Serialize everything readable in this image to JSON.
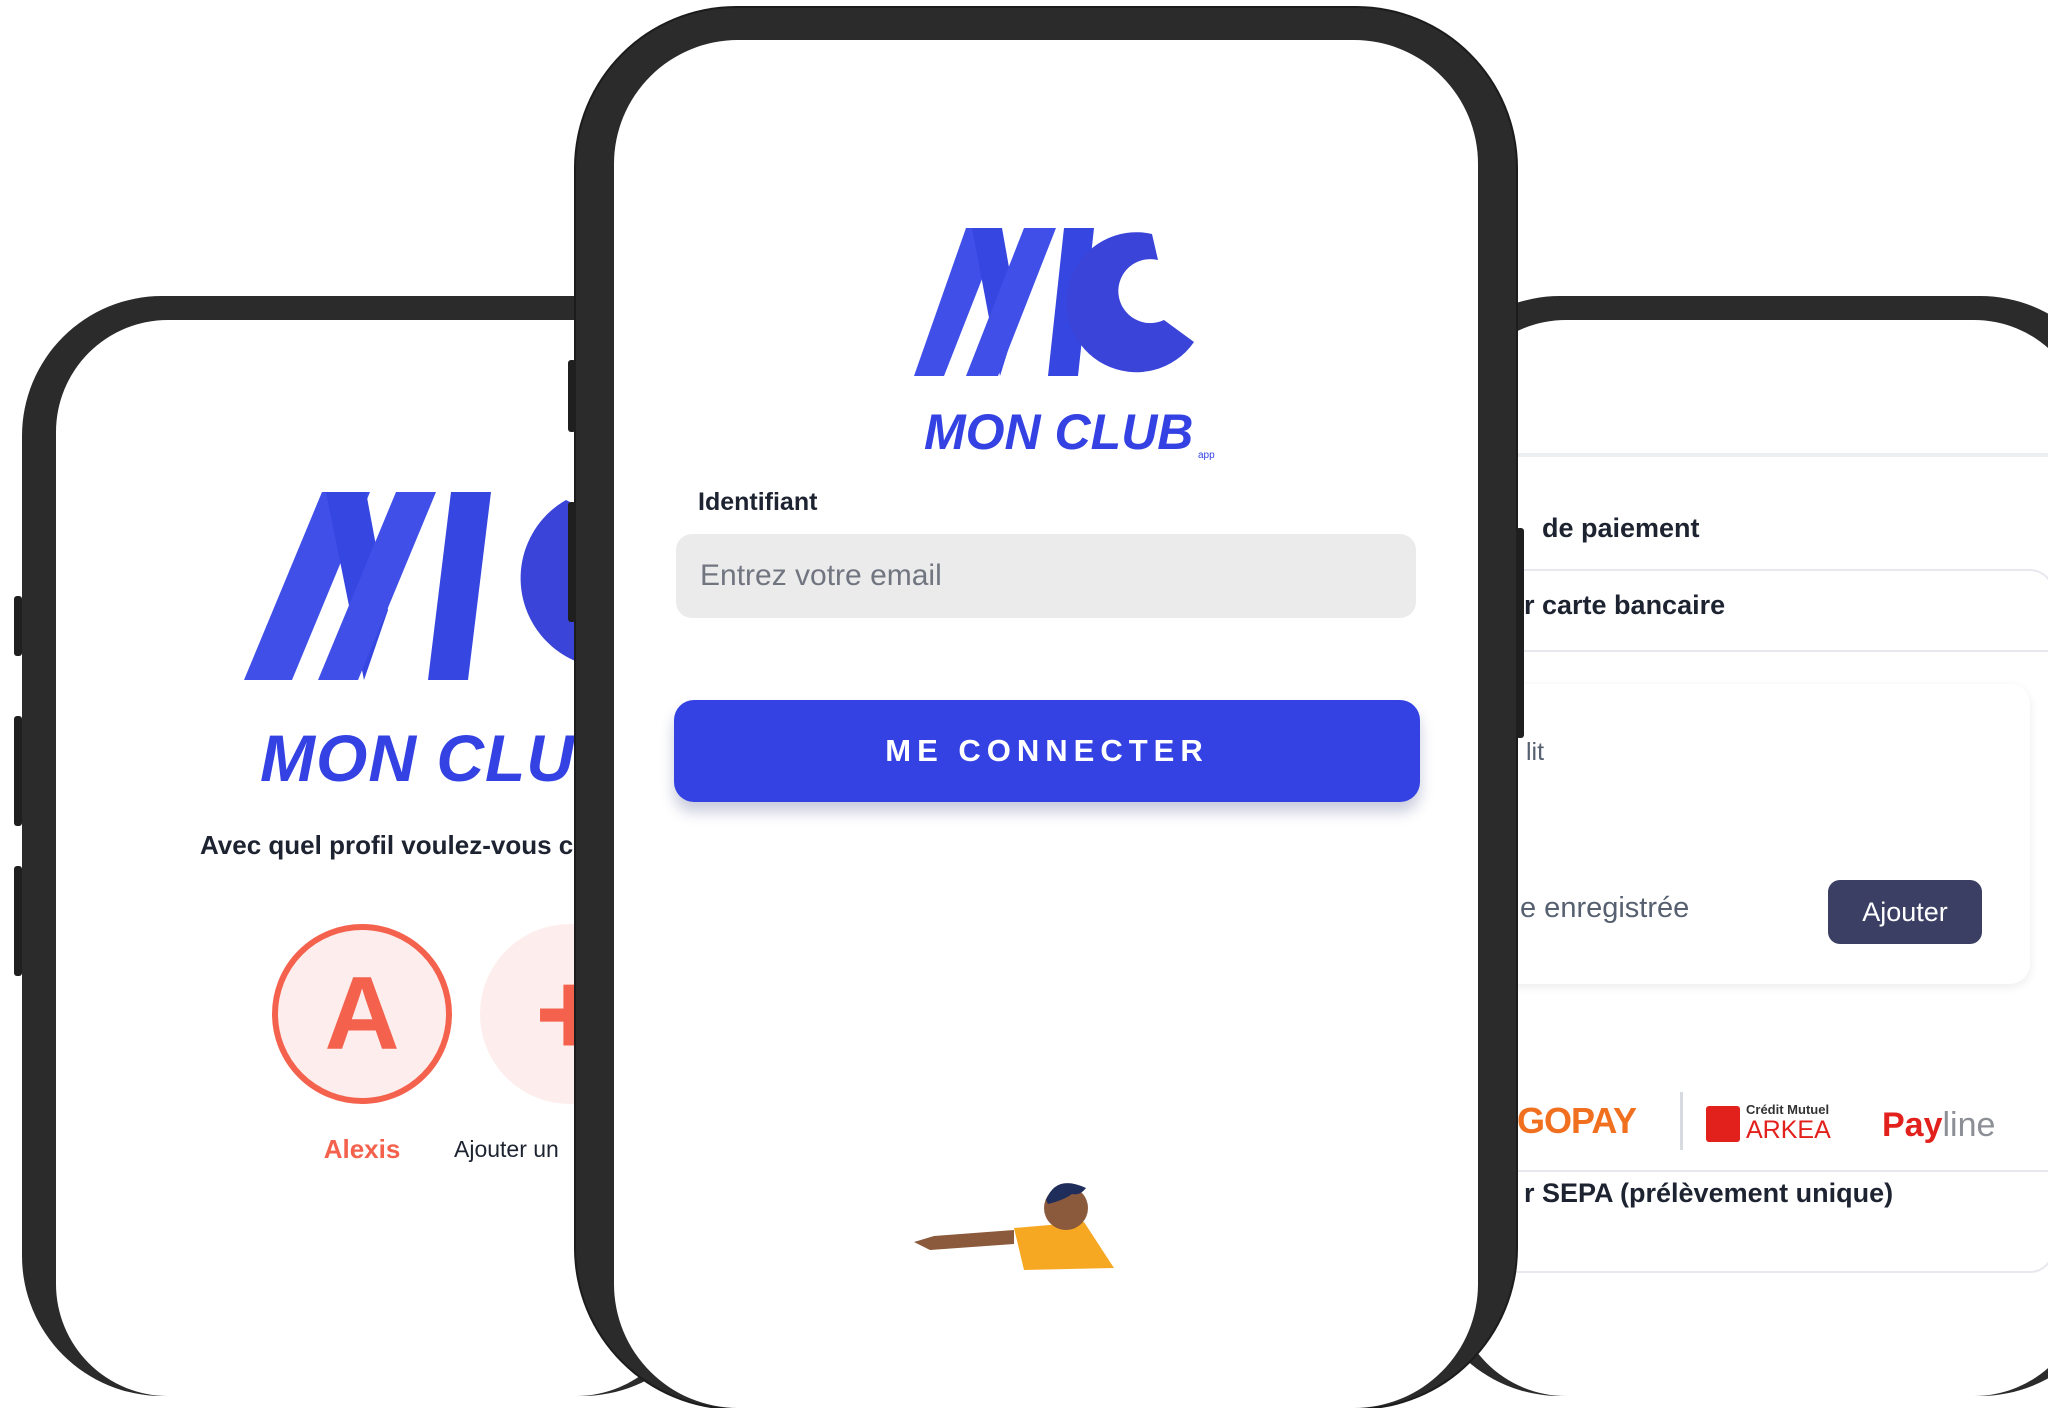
{
  "brand": {
    "name": "MON CLUB",
    "suffix": "app",
    "primary_color": "#3442e3",
    "accent_color": "#f4624e"
  },
  "left_phone": {
    "question": "Avec quel profil voulez-vous co",
    "profile": {
      "initial": "A",
      "name": "Alexis"
    },
    "add_symbol": "+",
    "add_label": "Ajouter un"
  },
  "center_phone": {
    "login_label": "Identifiant",
    "email_placeholder": "Entrez votre email",
    "email_value": "",
    "connect_button": "ME CONNECTER"
  },
  "right_phone": {
    "section_title": "de paiement",
    "card_title": "r carte bancaire",
    "credit_label": "lit",
    "saved_label": "e enregistrée",
    "add_button": "Ajouter",
    "mangopay": "NGOPAY",
    "arkea_small": "Crédit Mutuel",
    "arkea": "ARKEA",
    "payline_a": "Pay",
    "payline_b": "line",
    "sepa_title": "r SEPA (prélèvement unique)"
  }
}
